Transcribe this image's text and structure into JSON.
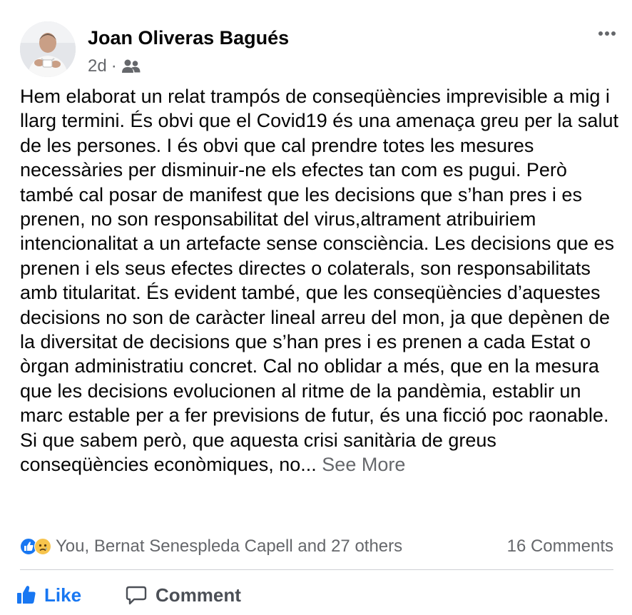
{
  "post": {
    "author_name": "Joan Oliveras Bagués",
    "time_ago": "2d",
    "meta_separator": "·",
    "audience_icon": "friends-icon",
    "more_icon": "more-options-icon",
    "body_text": "Hem elaborat un relat trampós de conseqüències imprevisible a mig i llarg termini. És obvi que el Covid19 és una amenaça greu per la salut de les persones. I és obvi que cal prendre totes les mesures necessàries per disminuir-ne els efectes tan com es pugui. Però també cal posar de manifest que les decisions que s’han pres i es prenen, no son responsabilitat del virus,altrament atribuiriem intencionalitat a un artefacte sense consciència. Les decisions que es prenen i els seus efectes directes o colaterals, son responsabilitats amb titularitat. És evident també, que les conseqüències d’aquestes decisions no son de caràcter lineal arreu del mon, ja que depènen de la diversitat de decisions que s’han pres i es prenen a cada Estat o òrgan administratiu concret. Cal no oblidar a més, que en la mesura que les decisions evolucionen al ritme de la pandèmia, establir un marc estable per a fer previsions de futur, és una ficció poc raonable. Si que sabem però, que aquesta crisi sanitària de greus conseqüències econòmiques, no...",
    "see_more": "See More"
  },
  "reactions": {
    "icons": [
      "like-reaction-icon",
      "sad-reaction-icon"
    ],
    "names": "You, Bernat Senespleda Capell and 27 others",
    "comments": "16 Comments"
  },
  "actions": {
    "like_label": "Like",
    "comment_label": "Comment"
  },
  "colors": {
    "accent": "#1877f2",
    "secondary_text": "#65676b",
    "primary_text": "#050505",
    "divider": "#ced0d4"
  }
}
